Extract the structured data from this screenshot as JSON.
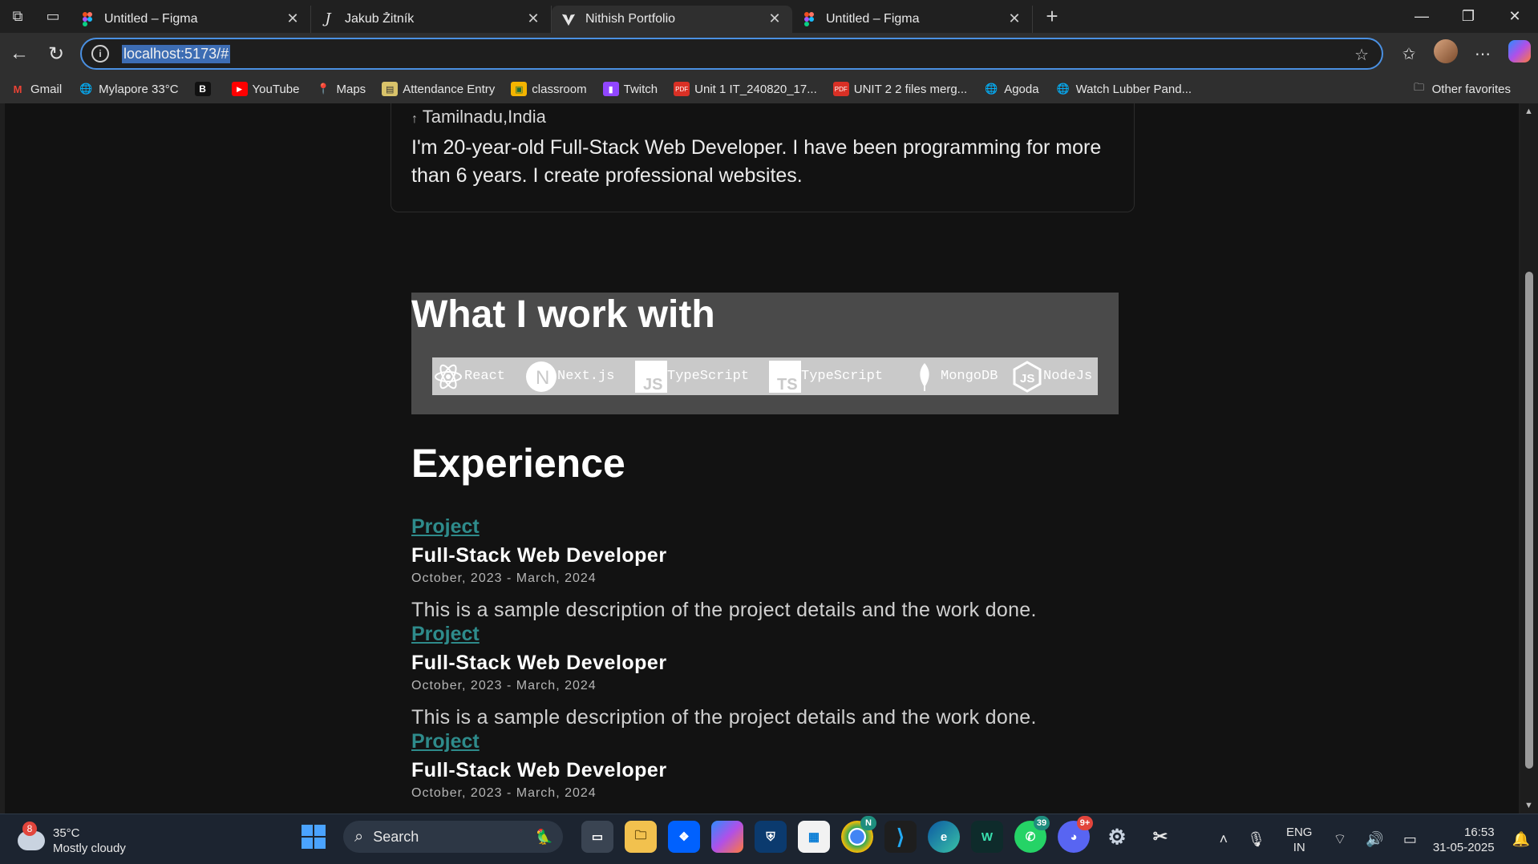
{
  "browser": {
    "tabs": [
      {
        "label": "Untitled – Figma",
        "icon": "figma-icon",
        "active": false
      },
      {
        "label": "Jakub Žitník",
        "icon": "j-logo-icon",
        "active": false
      },
      {
        "label": "Nithish Portfolio",
        "icon": "vite-logo-icon",
        "active": true
      },
      {
        "label": "Untitled – Figma",
        "icon": "figma-icon",
        "active": false
      }
    ],
    "url": "localhost:5173/#",
    "bookmarks": [
      {
        "label": "Gmail",
        "icon": "gmail-icon",
        "color": "#ea4335"
      },
      {
        "label": "Mylapore 33°C",
        "icon": "globe-icon",
        "color": "#cccccc"
      },
      {
        "label": "",
        "icon": "b-logo-icon",
        "color": "#1a1a1a"
      },
      {
        "label": "YouTube",
        "icon": "youtube-icon",
        "color": "#ff0000"
      },
      {
        "label": "Maps",
        "icon": "maps-pin-icon",
        "color": "#34a853"
      },
      {
        "label": "Attendance Entry",
        "icon": "attendance-icon",
        "color": "#d9c36a"
      },
      {
        "label": "classroom",
        "icon": "classroom-icon",
        "color": "#f4b400"
      },
      {
        "label": "Twitch",
        "icon": "twitch-icon",
        "color": "#9146ff"
      },
      {
        "label": "Unit 1 IT_240820_17...",
        "icon": "pdf-icon",
        "color": "#d93025"
      },
      {
        "label": "UNIT 2 2 files merg...",
        "icon": "pdf-icon",
        "color": "#d93025"
      },
      {
        "label": "Agoda",
        "icon": "globe-icon",
        "color": "#cccccc"
      },
      {
        "label": "Watch Lubber Pand...",
        "icon": "globe-icon",
        "color": "#cccccc"
      }
    ],
    "other_favorites": "Other favorites"
  },
  "page": {
    "location": "Tamilnadu,India",
    "bio": "I'm 20-year-old Full-Stack Web Developer. I have been programming for more than 6 years. I create professional websites.",
    "work_title": "What I work with",
    "tech": [
      {
        "label": "React",
        "icon": "react-icon"
      },
      {
        "label": "Next.js",
        "icon": "nextjs-icon"
      },
      {
        "label": "TypeScript",
        "icon": "javascript-icon"
      },
      {
        "label": "TypeScript",
        "icon": "typescript-icon"
      },
      {
        "label": "MongoDB",
        "icon": "mongodb-leaf-icon"
      },
      {
        "label": "NodeJs",
        "icon": "nodejs-icon"
      }
    ],
    "experience_title": "Experience",
    "experience": [
      {
        "link": "Project",
        "role": "Full-Stack Web Developer",
        "dates": "October, 2023 - March, 2024",
        "description": "This is a sample description of the project details and the work done."
      },
      {
        "link": "Project",
        "role": "Full-Stack Web Developer",
        "dates": "October, 2023 - March, 2024",
        "description": "This is a sample description of the project details and the work done."
      },
      {
        "link": "Project",
        "role": "Full-Stack Web Developer",
        "dates": "October, 2023 - March, 2024",
        "description": ""
      }
    ],
    "colors": {
      "link": "#2e8b8b",
      "background": "#121212",
      "work_panel": "#4a4a4a"
    }
  },
  "taskbar": {
    "weather": {
      "temp": "35°C",
      "condition": "Mostly cloudy",
      "badge": "8"
    },
    "search_placeholder": "Search",
    "whatsapp_count": "39",
    "discord_count": "9+",
    "chrome_badge": "N",
    "language": {
      "line1": "ENG",
      "line2": "IN"
    },
    "time": "16:53",
    "date": "31-05-2025"
  }
}
